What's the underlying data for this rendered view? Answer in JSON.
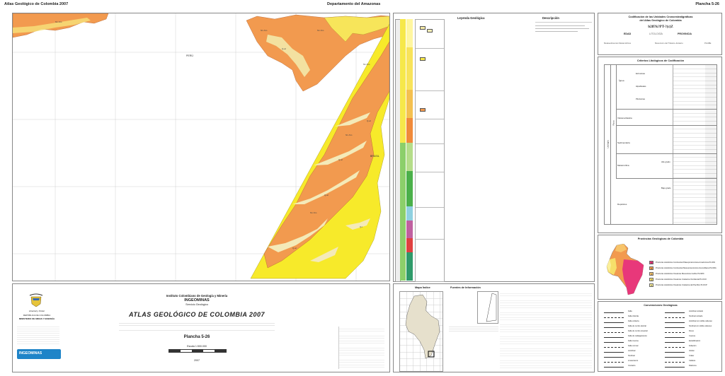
{
  "header": {
    "left": "Atlas Geológico de Colombia 2007",
    "center": "Departamento del Amazonas",
    "right": "Plancha 5-26"
  },
  "map": {
    "country_peru": "PERÚ",
    "country_brasil": "BRASIL",
    "unit_labels": [
      "N1-Sm",
      "N1-Sm",
      "N1-Sm",
      "N1-Sm",
      "N1-Sm",
      "Q-al",
      "Q-al",
      "Q-al",
      "Q-t",
      "Q-al",
      "N1-Sm",
      "Q-al"
    ]
  },
  "legend": {
    "title": "Leyenda Geológica",
    "description_title": "Descripción"
  },
  "codification": {
    "title_line1": "Codificación de las Unidades Cronoestratigráficas",
    "title_line2": "del Atlas Geológico de Colombia",
    "formula": "b2ff?k?PT-?(c)Z",
    "edad": "EDAD",
    "litologia": "LITOLOGÍA",
    "provincia": "PROVINCIA",
    "sub1": "Metasedimentos Metamórficos",
    "sub2": "Mesozoico del Triásico-Jurásico",
    "sub3": "PLGBE"
  },
  "criteria": {
    "title": "Criterios Litológicos de Codificación",
    "side": "Litología",
    "roca": "Roca",
    "groups": [
      "Ígnea",
      "Volcanoclástica",
      "Sedimentaria",
      "Metamórfica",
      "Depósitos"
    ],
    "subgroups": [
      "Extrusivas",
      "Hipabisales",
      "Plutónicas",
      "Alto grado",
      "Bajo grado"
    ]
  },
  "provinces": {
    "title": "Provincias Geológicas de Colombia",
    "items": [
      {
        "num": "1",
        "color": "#e8387a",
        "label": "Provincia Litosférica Continental Paleoproterozoica Amazónica PLCPA"
      },
      {
        "num": "2",
        "color": "#f5a04a",
        "label": "Provincia Litosférica Continental Mesoproterozoica Grenvilliana PLCMG"
      },
      {
        "num": "3",
        "color": "#f7c46a",
        "label": "Provincia Litosférica Oceánica Mesozoica Caribe PLOMC"
      },
      {
        "num": "4",
        "color": "#f6df6a",
        "label": "Provincia Litosférica Oceánica Cretácica Occidental PLOCO"
      },
      {
        "num": "5",
        "color": "#fbef9a",
        "label": "Provincia Litosférica Oceánica Cretácica del Pacífico PLOCP"
      }
    ]
  },
  "conventions": {
    "title": "Convenciones Geológicas",
    "left": [
      "Falla",
      "Falla inferida",
      "Falla cubierta",
      "Falla de rumbo dextral",
      "Falla de rumbo sinestral",
      "Falla de cabalgamiento",
      "Falla inversa",
      "Falla normal",
      "Anticlinal",
      "Sinclinal",
      "Lineamiento",
      "Contacto"
    ],
    "right": [
      "Anticlinal volcado",
      "Sinclinal volcado",
      "Anticlinal con doble cabeceo",
      "Sinclinal con doble cabeceo",
      "Domo",
      "Cuenca",
      "Estratificación",
      "Foliación",
      "Volcán",
      "Cráter",
      "Caldera",
      "Diatrema"
    ]
  },
  "footer": {
    "institute": "Instituto Colombiano de Geología y Minería",
    "ingeominas": "INGEOMINAS",
    "service": "Servicio Geológico",
    "atlas": "ATLAS GEOLÓGICO DE COLOMBIA 2007",
    "plancha": "Plancha 5-26",
    "escala": "Escala 1:500.000",
    "year": "2007",
    "republica": "REPÚBLICA DE COLOMBIA",
    "ministerio": "MINISTERIO DE MINAS Y ENERGÍA",
    "lema": "Libertad y Orden",
    "logo_text": "INGEOMINAS",
    "index_title": "Mapa Índice",
    "sources_title": "Fuentes de Información"
  }
}
